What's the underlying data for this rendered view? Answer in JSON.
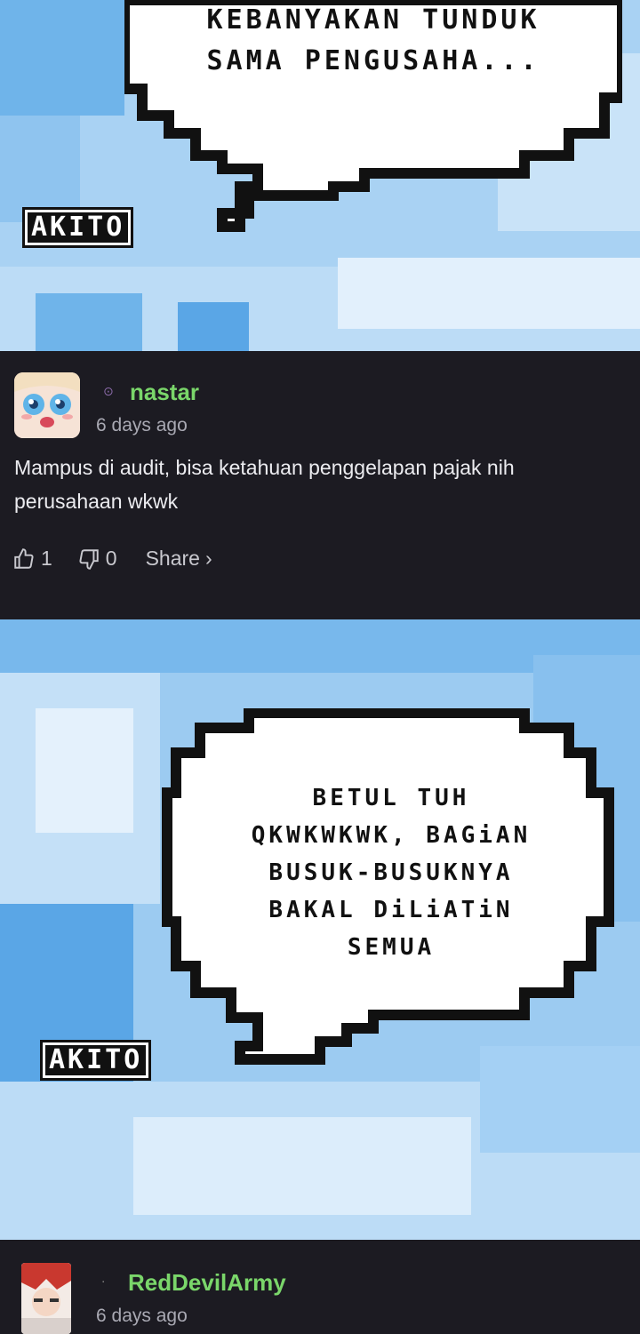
{
  "panel1": {
    "bubble_lines": [
      "KEBANYAKAN TUNDUK",
      "SAMA PENGUSAHA..."
    ],
    "speaker": "AKITO"
  },
  "comment1": {
    "username": "nastar",
    "time": "6 days ago",
    "text": "Mampus di audit, bisa ketahuan penggelapan pajak nih perusahaan wkwk",
    "likes": "1",
    "dislikes": "0",
    "share_label": "Share",
    "share_icon": "chevron-right-icon"
  },
  "panel2": {
    "bubble_lines": [
      "BETUL TUH",
      "QKWKWKWK, BAGiAN",
      "BUSUK-BUSUKNYA",
      "BAKAL DiLiATiN",
      "SEMUA"
    ],
    "speaker": "AKITO"
  },
  "comment2": {
    "username": "RedDevilArmy",
    "time": "6 days ago"
  },
  "colors": {
    "sky": "#a9d2f3",
    "sky_dark": "#5aa6e6",
    "sky_light": "#d6eafb",
    "page_bg": "#1c1b22",
    "username": "#7ad66a"
  }
}
